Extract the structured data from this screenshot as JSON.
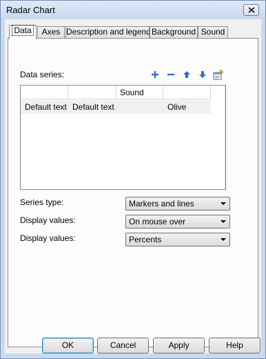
{
  "window": {
    "title": "Radar Chart"
  },
  "tabs": [
    {
      "label": "Data",
      "active": true
    },
    {
      "label": "Axes",
      "active": false
    },
    {
      "label": "Description and legend",
      "active": false
    },
    {
      "label": "Background",
      "active": false
    },
    {
      "label": "Sound",
      "active": false
    }
  ],
  "data_series": {
    "label": "Data series:",
    "toolbar": [
      "add-icon",
      "remove-icon",
      "move-up-icon",
      "move-down-icon",
      "properties-icon"
    ],
    "columns": [
      "",
      "",
      "Sound",
      ""
    ],
    "rows": [
      [
        "Default text",
        "Default text",
        "",
        "Olive"
      ]
    ]
  },
  "settings": {
    "series_type_label": "Series type:",
    "series_type_value": "Markers and lines",
    "display_values_label_1": "Display values:",
    "display_values_value_1": "On mouse over",
    "display_values_label_2": "Display values:",
    "display_values_value_2": "Percents"
  },
  "buttons": {
    "ok": "OK",
    "cancel": "Cancel",
    "apply": "Apply",
    "help": "Help"
  },
  "colors": {
    "accent": "#2e6fc7",
    "window_border": "#6f8fb5"
  }
}
